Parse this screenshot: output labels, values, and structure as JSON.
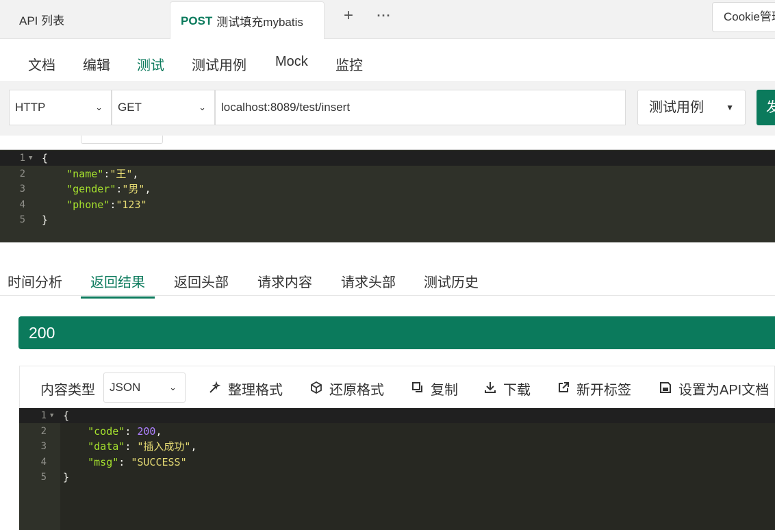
{
  "top_tabs": {
    "list_label": "API 列表",
    "active_method": "POST",
    "active_name": "测试填充mybatis",
    "add": "+",
    "more": "···",
    "cookie_label": "Cookie管理"
  },
  "subnav": [
    "文档",
    "编辑",
    "测试",
    "测试用例",
    "Mock",
    "监控"
  ],
  "request": {
    "protocol": "HTTP",
    "method": "GET",
    "url": "localhost:8089/test/insert",
    "testcase_label": "测试用例",
    "send_label": "发送"
  },
  "request_body": {
    "line_numbers": [
      "1",
      "2",
      "3",
      "4",
      "5"
    ],
    "lines": [
      [
        {
          "t": "{",
          "c": "p"
        }
      ],
      [
        {
          "t": "    ",
          "c": "p"
        },
        {
          "t": "\"name\"",
          "c": "k"
        },
        {
          "t": ":",
          "c": "p"
        },
        {
          "t": "\"王\"",
          "c": "s"
        },
        {
          "t": ",",
          "c": "p"
        }
      ],
      [
        {
          "t": "    ",
          "c": "p"
        },
        {
          "t": "\"gender\"",
          "c": "k"
        },
        {
          "t": ":",
          "c": "p"
        },
        {
          "t": "\"男\"",
          "c": "s"
        },
        {
          "t": ",",
          "c": "p"
        }
      ],
      [
        {
          "t": "    ",
          "c": "p"
        },
        {
          "t": "\"phone\"",
          "c": "k"
        },
        {
          "t": ":",
          "c": "p"
        },
        {
          "t": "\"123\"",
          "c": "s"
        }
      ],
      [
        {
          "t": "}",
          "c": "p"
        }
      ]
    ]
  },
  "result_tabs": [
    "时间分析",
    "返回结果",
    "返回头部",
    "请求内容",
    "请求头部",
    "测试历史"
  ],
  "status_code": "200",
  "toolbar": {
    "content_type_label": "内容类型",
    "content_type_value": "JSON",
    "format": "整理格式",
    "restore": "还原格式",
    "copy": "复制",
    "download": "下载",
    "new_tab": "新开标签",
    "set_doc": "设置为API文档"
  },
  "response_body": {
    "line_numbers": [
      "1",
      "2",
      "3",
      "4",
      "5"
    ],
    "lines": [
      [
        {
          "t": "{",
          "c": "p"
        }
      ],
      [
        {
          "t": "    ",
          "c": "p"
        },
        {
          "t": "\"code\"",
          "c": "k"
        },
        {
          "t": ": ",
          "c": "p"
        },
        {
          "t": "200",
          "c": "n"
        },
        {
          "t": ",",
          "c": "p"
        }
      ],
      [
        {
          "t": "    ",
          "c": "p"
        },
        {
          "t": "\"data\"",
          "c": "k"
        },
        {
          "t": ": ",
          "c": "p"
        },
        {
          "t": "\"插入成功\"",
          "c": "s"
        },
        {
          "t": ",",
          "c": "p"
        }
      ],
      [
        {
          "t": "    ",
          "c": "p"
        },
        {
          "t": "\"msg\"",
          "c": "k"
        },
        {
          "t": ": ",
          "c": "p"
        },
        {
          "t": "\"SUCCESS\"",
          "c": "s"
        }
      ],
      [
        {
          "t": "}",
          "c": "p"
        }
      ]
    ]
  },
  "colors": {
    "accent": "#0b7a5c",
    "editor_bg": "#272822"
  }
}
